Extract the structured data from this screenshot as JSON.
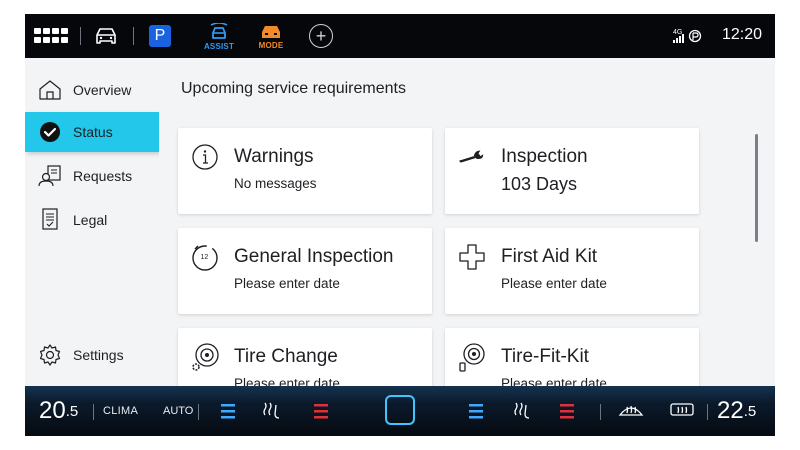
{
  "status_bar": {
    "time": "12:20",
    "network": "4G",
    "park_label": "P",
    "assist_label": "ASSIST",
    "mode_label": "MODE",
    "add_label": "+"
  },
  "sidebar": {
    "items": [
      {
        "label": "Overview",
        "icon": "house-icon"
      },
      {
        "label": "Status",
        "icon": "check-circle-icon",
        "active": true
      },
      {
        "label": "Requests",
        "icon": "person-document-icon"
      },
      {
        "label": "Legal",
        "icon": "document-icon"
      },
      {
        "label": "Settings",
        "icon": "gear-icon"
      }
    ]
  },
  "main": {
    "title": "Upcoming service requirements",
    "cards": [
      {
        "title": "Warnings",
        "subtitle": "No messages",
        "icon": "info-icon"
      },
      {
        "title": "Inspection",
        "subtitle": "103 Days",
        "icon": "wrench-icon"
      },
      {
        "title": "General Inspection",
        "subtitle": "Please enter date",
        "icon": "clock-12-icon"
      },
      {
        "title": "First Aid Kit",
        "subtitle": "Please enter date",
        "icon": "cross-icon"
      },
      {
        "title": "Tire Change",
        "subtitle": "Please enter date",
        "icon": "tire-gear-icon"
      },
      {
        "title": "Tire-Fit-Kit",
        "subtitle": "Please enter date",
        "icon": "tire-bottle-icon"
      }
    ]
  },
  "climate": {
    "left_temp_whole": "20",
    "left_temp_decimal": ".5",
    "clima_label": "CLIMA",
    "auto_label": "AUTO",
    "right_temp_whole": "22",
    "right_temp_decimal": ".5"
  },
  "colors": {
    "accent": "#23c7ea",
    "park_blue": "#1a63e0",
    "assist_blue": "#2f9bf5",
    "mode_orange": "#f08a2a",
    "seat_heat_red": "#e0303a",
    "cool_blue": "#3fa8ff"
  }
}
